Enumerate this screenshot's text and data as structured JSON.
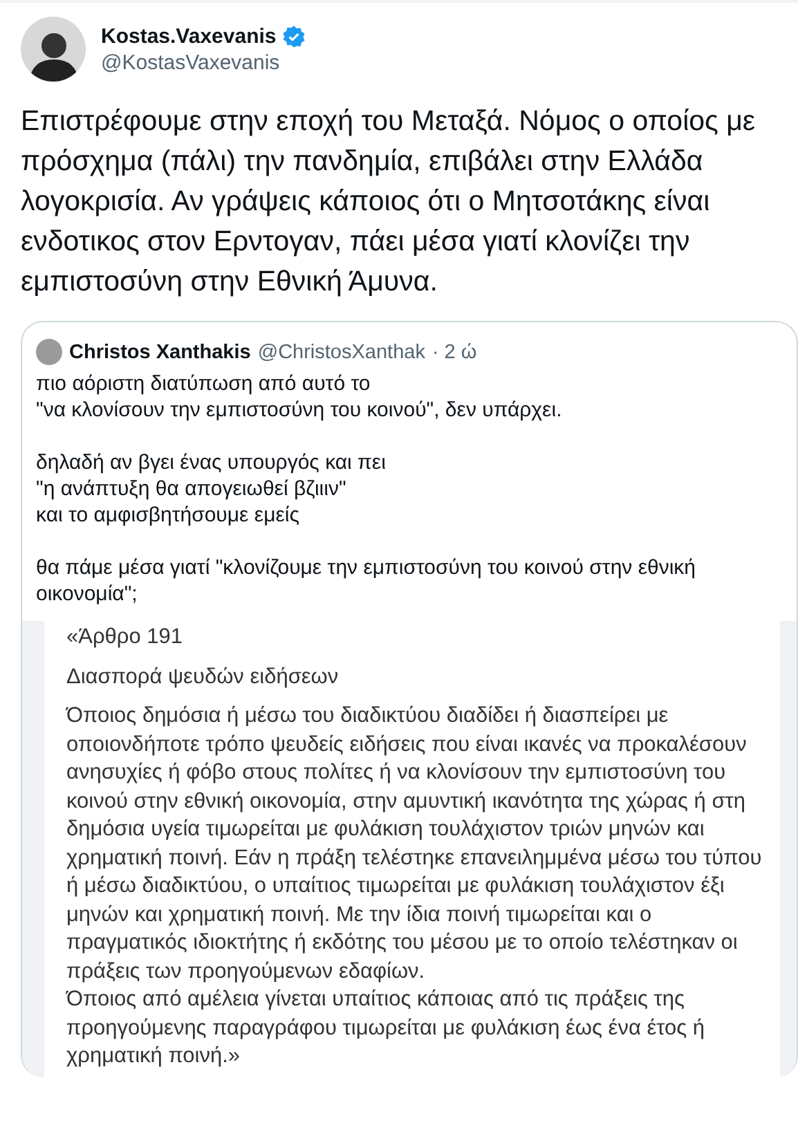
{
  "author": {
    "name": "Kostas.Vaxevanis",
    "handle": "@KostasVaxevanis",
    "verified": true
  },
  "tweet_text": "Επιστρέφουμε στην εποχή του Μεταξά. Νόμος ο οποίος με πρόσχημα (πάλι) την πανδημία, επιβάλει στην Ελλάδα λογοκρισία. Αν γράψεις κάποιος ότι ο Μητσοτάκης είναι ενδοτικος στον Ερντογαν, πάει μέσα γιατί κλονίζει την εμπιστοσύνη στην Εθνική Άμυνα.",
  "quoted_tweet": {
    "name": "Christos Xanthakis",
    "handle": "@ChristosXanthak",
    "time": "· 2 ώ",
    "paragraphs": [
      [
        "πιο αόριστη διατύπωση από αυτό το",
        "\"να κλονίσουν την εμπιστοσύνη του κοινού\", δεν υπάρχει."
      ],
      [
        "δηλαδή αν βγει ένας υπουργός και πει",
        "\"η ανάπτυξη θα απογειωθεί βζιιιν\"",
        "και το αμφισβητήσουμε εμείς"
      ],
      [
        "θα πάμε μέσα γιατί \"κλονίζουμε την εμπιστοσύνη του κοινού στην εθνική οικονομία\";"
      ]
    ],
    "document": {
      "article": "«Άρθρο 191",
      "heading": "Διασπορά ψευδών ειδήσεων",
      "paragraphs": [
        "Όποιος δημόσια ή μέσω του διαδικτύου διαδίδει ή διασπείρει με οποιονδήποτε τρόπο ψευδείς ειδήσεις που είναι ικανές να προκαλέσουν ανησυχίες ή φόβο στους πολίτες ή να κλονίσουν την εμπιστοσύνη του κοινού στην εθνική οικονομία, στην αμυντική ικανότητα της χώρας ή στη δημόσια υγεία τιμωρείται με φυλάκιση τουλάχιστον τριών μηνών και χρηματική ποινή. Εάν η πράξη τελέστηκε επανειλημμένα μέσω του τύπου ή μέσω διαδικτύου, ο υπαίτιος τιμωρείται με φυλάκιση τουλάχιστον έξι μηνών και χρηματική ποινή. Με την ίδια ποινή τιμωρείται και ο πραγματικός ιδιοκτήτης ή εκδότης του μέσου με το οποίο τελέστηκαν οι πράξεις των προηγούμενων εδαφίων.",
        "Όποιος από αμέλεια γίνεται υπαίτιος κάποιας από τις πράξεις της προηγούμενης παραγράφου τιμωρείται με φυλάκιση έως ένα έτος ή χρηματική ποινή.»"
      ]
    }
  }
}
